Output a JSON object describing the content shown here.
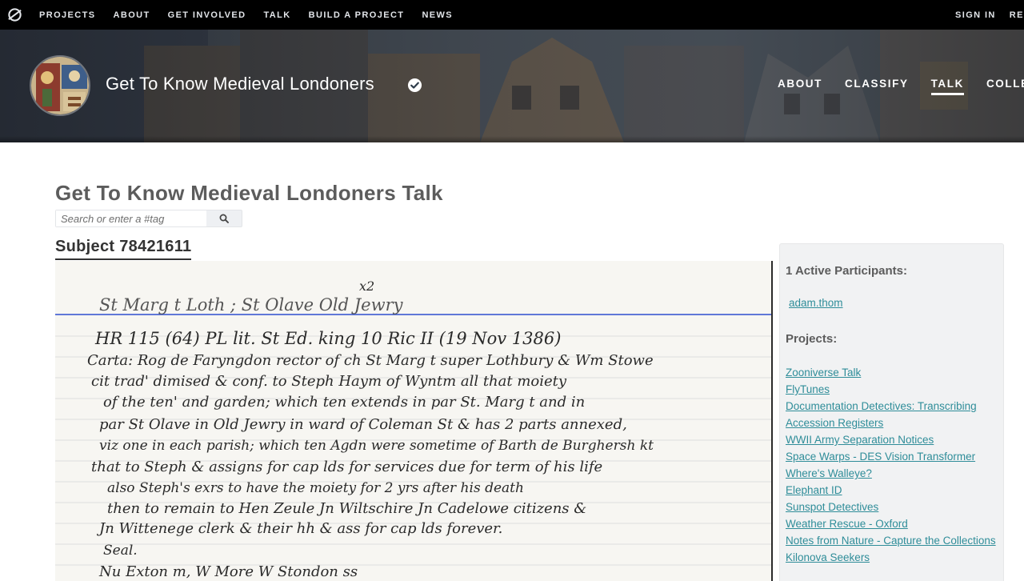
{
  "site_nav": {
    "links": [
      "PROJECTS",
      "ABOUT",
      "GET INVOLVED",
      "TALK",
      "BUILD A PROJECT",
      "NEWS"
    ],
    "right_links": [
      "SIGN IN",
      "REGI"
    ]
  },
  "project": {
    "title": "Get To Know Medieval Londoners",
    "links": [
      "ABOUT",
      "CLASSIFY",
      "TALK",
      "COLLECT"
    ],
    "active_link": "TALK"
  },
  "talk": {
    "title": "Get To Know Medieval Londoners Talk",
    "search_placeholder": "Search or enter a #tag",
    "subject_title": "Subject 78421611"
  },
  "sidebar": {
    "participants_heading": "1 Active Participants:",
    "participants": [
      "adam.thom"
    ],
    "projects_heading": "Projects:",
    "projects": [
      "Zooniverse Talk",
      "FlyTunes",
      "Documentation Detectives: Transcribing Accession Registers",
      "WWII Army Separation Notices",
      "Space Warps - DES Vision Transformer",
      "Where's Walleye?",
      "Elephant ID",
      "Sunspot Detectives",
      "Weather Rescue - Oxford",
      "Notes from Nature - Capture the Collections",
      "Kilonova Seekers"
    ]
  },
  "manuscript": {
    "lines": [
      "x2",
      "St Marg t Loth ; St Olave Old Jewry",
      "HR 115 (64)     PL lit. St Ed. king   10 Ric II   (19 Nov 1386)",
      "Carta:   Rog de Faryngdon rector of ch St Marg t super Lothbury & Wm Stowe",
      "cit    trad' dimised & conf. to Steph Haym of Wyntm all that moiety",
      "of the ten' and garden; which ten extends in par St. Marg t and in",
      "par St Olave in Old Jewry in ward of Coleman St & has 2 parts annexed,",
      "viz one in each parish; which ten Agdn were sometime of Barth de Burghersh kt",
      "that to Steph & assigns for cap lds for services due for term of his life",
      "also Steph's exrs to have the moiety for 2 yrs after his death",
      "then to remain to Hen Zeule Jn Wiltschire Jn Cadelowe citizens &",
      "Jn Wittenege clerk & their hh & ass for cap lds forever.",
      "Seal.",
      "Nu Exton m,   W More    W Stondon ss"
    ]
  },
  "colors": {
    "nav_bg": "#000000",
    "link_teal": "#2f8d99",
    "text_grey": "#5c5c5c",
    "sidebar_bg": "#f1f2f3",
    "ruled_blue": "#2e4fd0",
    "ink": "#2a2a2a"
  }
}
